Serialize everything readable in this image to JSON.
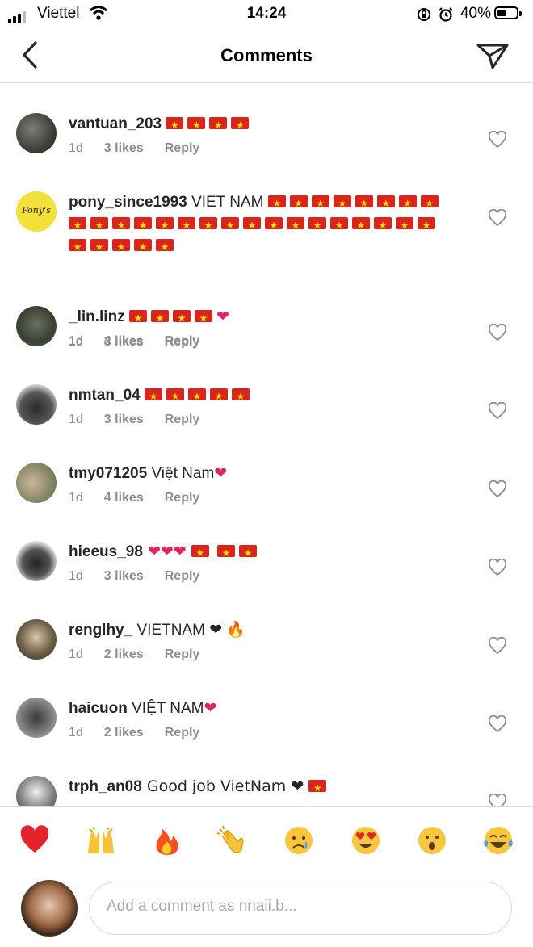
{
  "status_bar": {
    "carrier": "Viettel",
    "time": "14:24",
    "battery": "40%"
  },
  "header": {
    "title": "Comments"
  },
  "comments": [
    {
      "user": "vantuan_203",
      "text": "",
      "flags": 4,
      "tail": "",
      "age": "1d",
      "likes": "3 likes",
      "reply": "Reply"
    },
    {
      "user": "pony_since1993",
      "text": " VIET NAM ",
      "flags": 30,
      "tail": "",
      "age": "1d",
      "likes": "3 likes",
      "reply": "Reply"
    },
    {
      "user": "_lin.linz",
      "text": "",
      "flags": 4,
      "tail": "❤",
      "age": "1d",
      "likes": "4 likes",
      "reply": "Reply"
    },
    {
      "user": "nmtan_04",
      "text": "",
      "flags": 5,
      "tail": "",
      "age": "1d",
      "likes": "3 likes",
      "reply": "Reply"
    },
    {
      "user": "tmy071205",
      "text": " Việt Nam",
      "flags": 0,
      "tail": "❤",
      "age": "1d",
      "likes": "4 likes",
      "reply": "Reply"
    },
    {
      "user": "hieeus_98",
      "text": " ❤❤❤ ",
      "flags": 3,
      "tail": "",
      "age": "1d",
      "likes": "3 likes",
      "reply": "Reply"
    },
    {
      "user": "renglhy_",
      "text": " VIETNAM ❤ ",
      "flags": 0,
      "tail": "🔥",
      "age": "1d",
      "likes": "2 likes",
      "reply": "Reply"
    },
    {
      "user": "haicuon",
      "text": " VIỆT NAM",
      "flags": 0,
      "tail": "❤",
      "age": "1d",
      "likes": "2 likes",
      "reply": "Reply"
    },
    {
      "user": "trph_an08",
      "text": " Good job VietNam ❤ ",
      "flags": 1,
      "tail": "",
      "age": "",
      "likes": "",
      "reply": ""
    }
  ],
  "reactions": [
    "red-heart",
    "raising-hands",
    "fire",
    "clapping-hands",
    "crying-face",
    "heart-eyes",
    "surprised-face",
    "tears-of-joy"
  ],
  "composer": {
    "placeholder": "Add a comment as nnaii.b..."
  },
  "colors": {
    "flag_red": "#da251d",
    "flag_star": "#ffdd00",
    "muted": "#8e8e8e",
    "heart": "#e0245e"
  }
}
